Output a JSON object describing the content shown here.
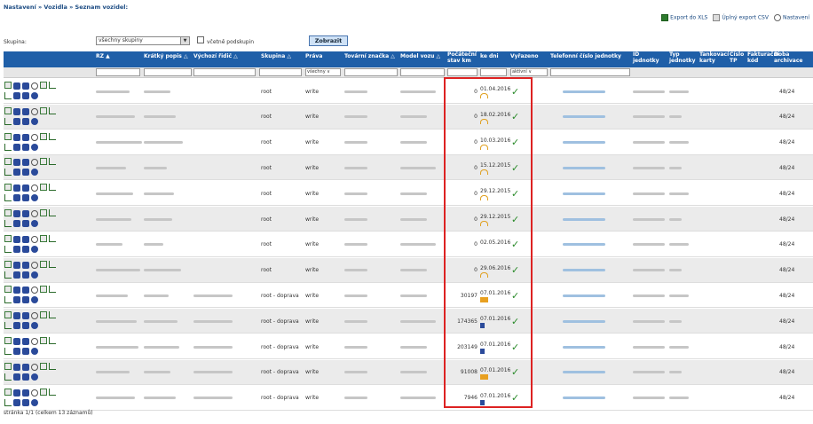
{
  "breadcrumb": "Nastavení » Vozidla » Seznam vozidel:",
  "exports": {
    "xls": "Export do XLS",
    "csv": "Úplný export CSV",
    "settings": "Nastavení"
  },
  "filter": {
    "label": "Skupina:",
    "group_value": "všechny skupiny",
    "subgroups_label": "včetně podskupin",
    "show_button": "Zobrazit"
  },
  "columns": {
    "rz": "RZ",
    "short_desc": "Krátký popis",
    "default_driver": "Výchozí řidič",
    "group": "Skupina",
    "rights": "Práva",
    "brand": "Tovární značka",
    "model": "Model vozu",
    "odometer": "Počáteční stav km",
    "days": "ke dni",
    "discarded": "Vyřazeno",
    "phone": "Telefonní číslo jednotky",
    "unit_id": "ID jednotky",
    "unit_type": "Typ jednotky",
    "fuel_card": "Tankovací karty",
    "tp_number": "Číslo TP",
    "invoice_code": "Fakturační kód",
    "archive": "Doba archivace"
  },
  "filters": {
    "rights": "všechny",
    "discarded": "aktivní"
  },
  "rows": [
    {
      "group": "root",
      "rights": "write",
      "km": "0",
      "date": "01.04.2016",
      "icon": "sun",
      "archive": "48/24"
    },
    {
      "group": "root",
      "rights": "write",
      "km": "0",
      "date": "18.02.2016",
      "icon": "sun",
      "archive": "48/24"
    },
    {
      "group": "root",
      "rights": "write",
      "km": "0",
      "date": "10.03.2016",
      "icon": "sun",
      "archive": "48/24"
    },
    {
      "group": "root",
      "rights": "write",
      "km": "0",
      "date": "15.12.2015",
      "icon": "sun",
      "archive": "48/24"
    },
    {
      "group": "root",
      "rights": "write",
      "km": "0",
      "date": "29.12.2015",
      "icon": "sun",
      "archive": "48/24"
    },
    {
      "group": "root",
      "rights": "write",
      "km": "0",
      "date": "29.12.2015",
      "icon": "sun",
      "archive": "48/24"
    },
    {
      "group": "root",
      "rights": "write",
      "km": "0",
      "date": "02.05.2016",
      "icon": "none",
      "archive": "48/24"
    },
    {
      "group": "root",
      "rights": "write",
      "km": "0",
      "date": "29.06.2016",
      "icon": "sun",
      "archive": "48/24"
    },
    {
      "group": "root - doprava",
      "rights": "write",
      "km": "30197",
      "date": "07.01.2016",
      "icon": "truck",
      "archive": "48/24"
    },
    {
      "group": "root - doprava",
      "rights": "write",
      "km": "174365",
      "date": "07.01.2016",
      "icon": "fuel",
      "archive": "48/24"
    },
    {
      "group": "root - doprava",
      "rights": "write",
      "km": "203149",
      "date": "07.01.2016",
      "icon": "fuel",
      "archive": "48/24"
    },
    {
      "group": "root - doprava",
      "rights": "write",
      "km": "91008",
      "date": "07.01.2016",
      "icon": "truck",
      "archive": "48/24"
    },
    {
      "group": "root - doprava",
      "rights": "write",
      "km": "7946",
      "date": "07.01.2016",
      "icon": "fuel",
      "archive": "48/24"
    }
  ],
  "footer": "stránka 1/1 (celkem 13 záznamů)"
}
